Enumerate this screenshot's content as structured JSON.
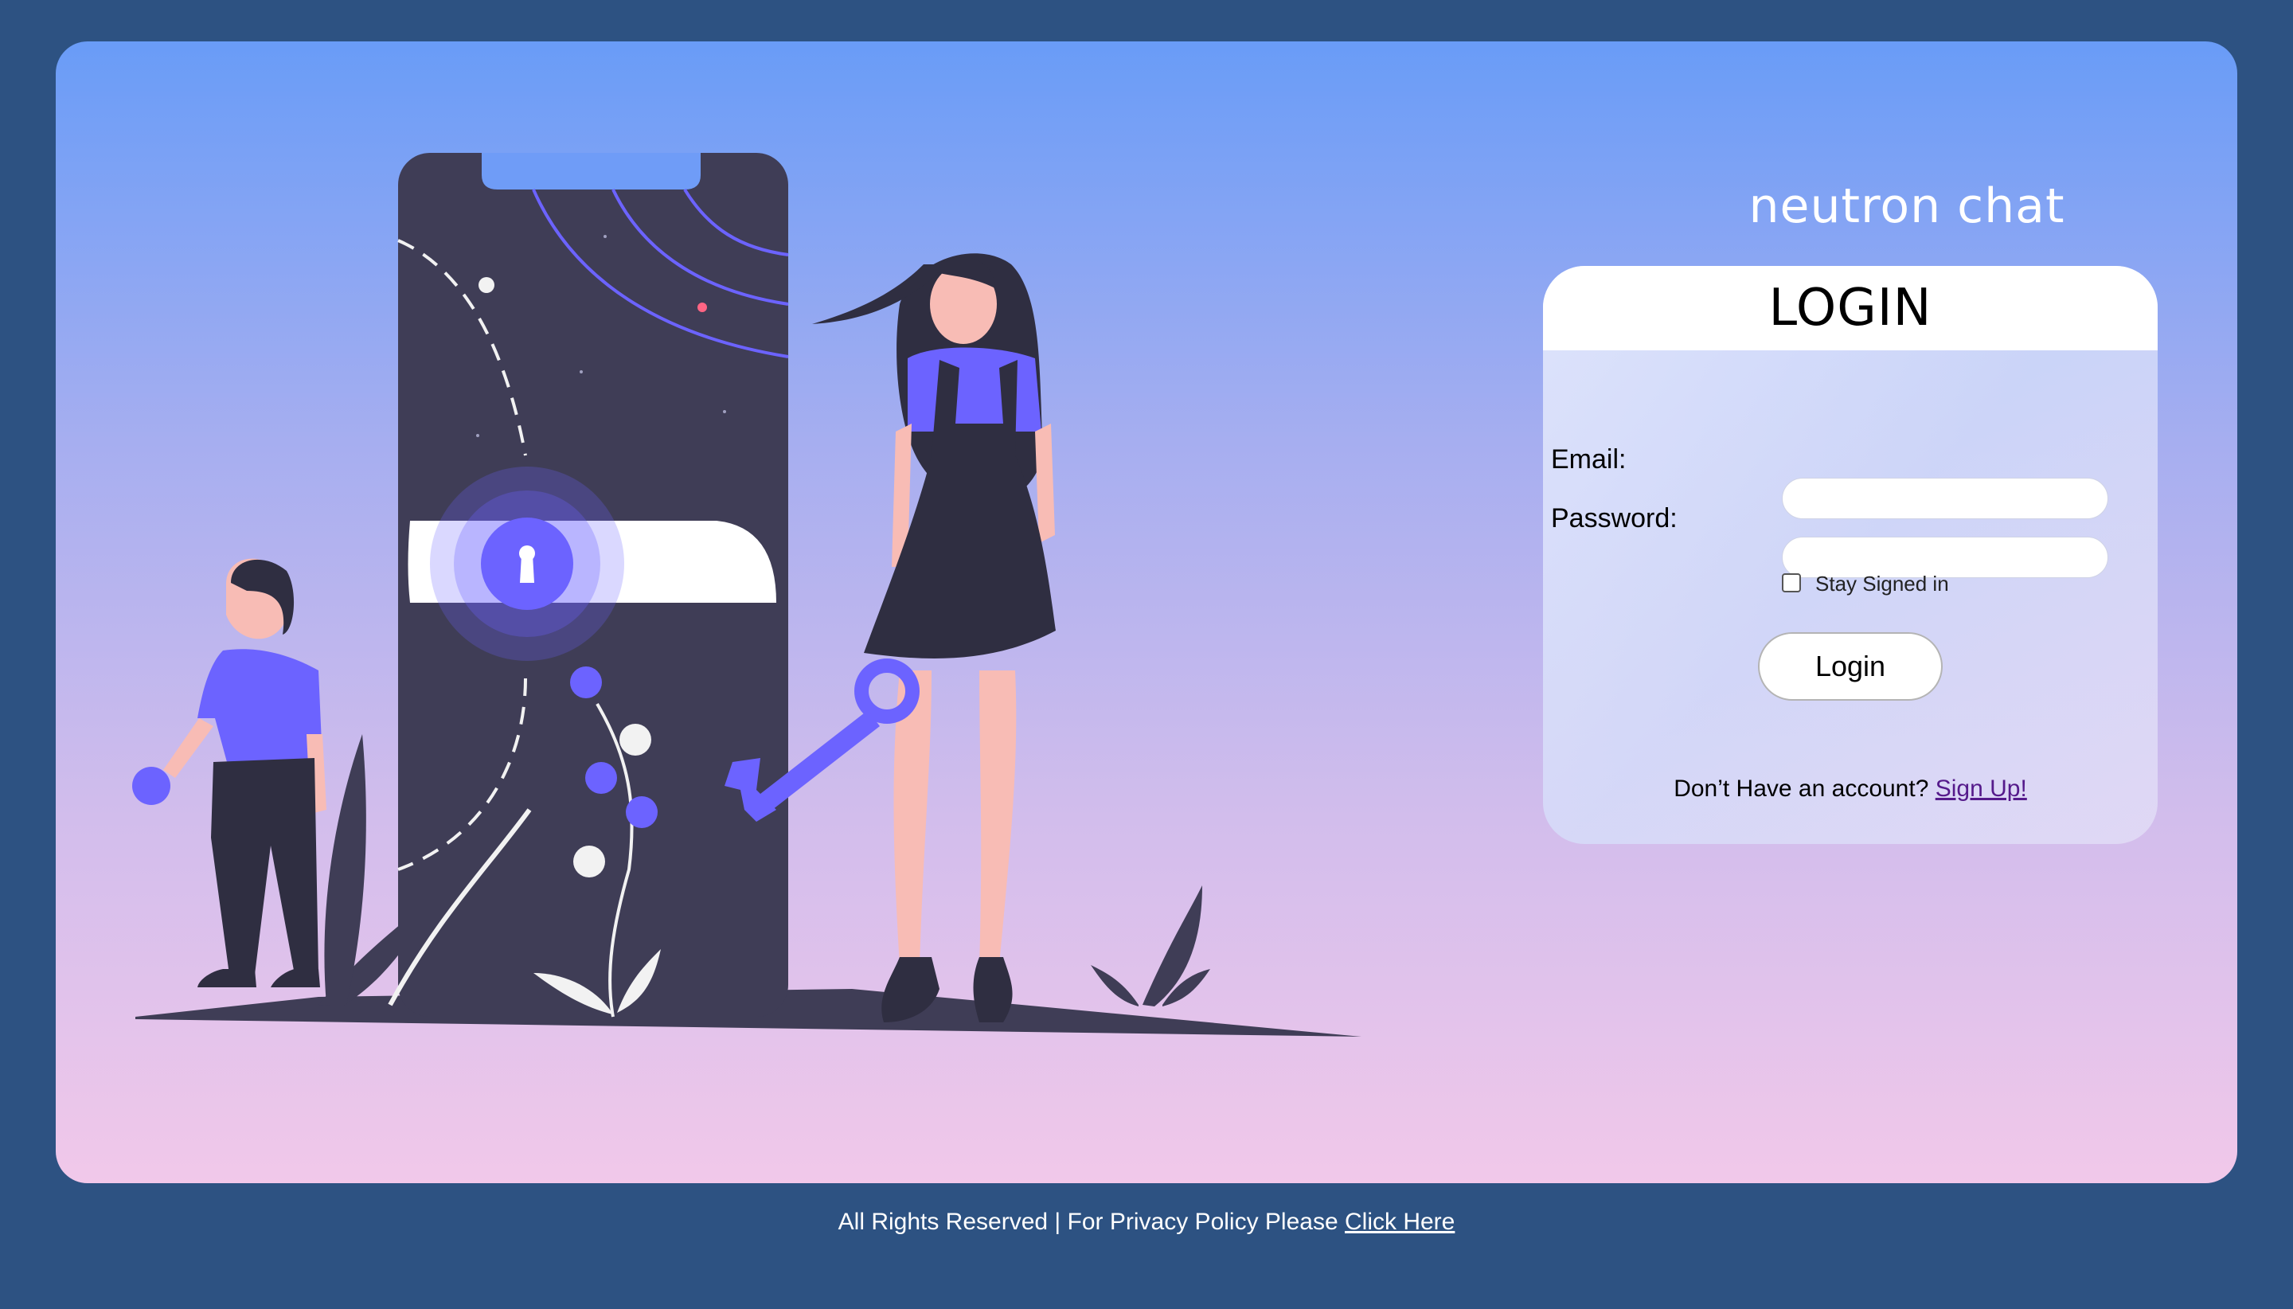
{
  "brand": {
    "title": "neutron chat"
  },
  "login": {
    "heading": "LOGIN",
    "email_label": "Email:",
    "email_value": "",
    "password_label": "Password:",
    "password_value": "",
    "stay_signed_label": "Stay Signed in",
    "stay_signed_checked": false,
    "submit_label": "Login",
    "signup_prompt": "Don’t Have an account?",
    "signup_link": "Sign Up!"
  },
  "footer": {
    "text": "All Rights Reserved | For Privacy Policy Please",
    "link": "Click Here"
  },
  "colors": {
    "page_bg": "#2d5282",
    "gradient_top": "#699cf7",
    "gradient_bottom": "#f1c8ea",
    "accent_purple": "#6c63ff",
    "dark_figure": "#3f3d56"
  },
  "illustration": {
    "icon": "phone-lock-key-illustration"
  }
}
